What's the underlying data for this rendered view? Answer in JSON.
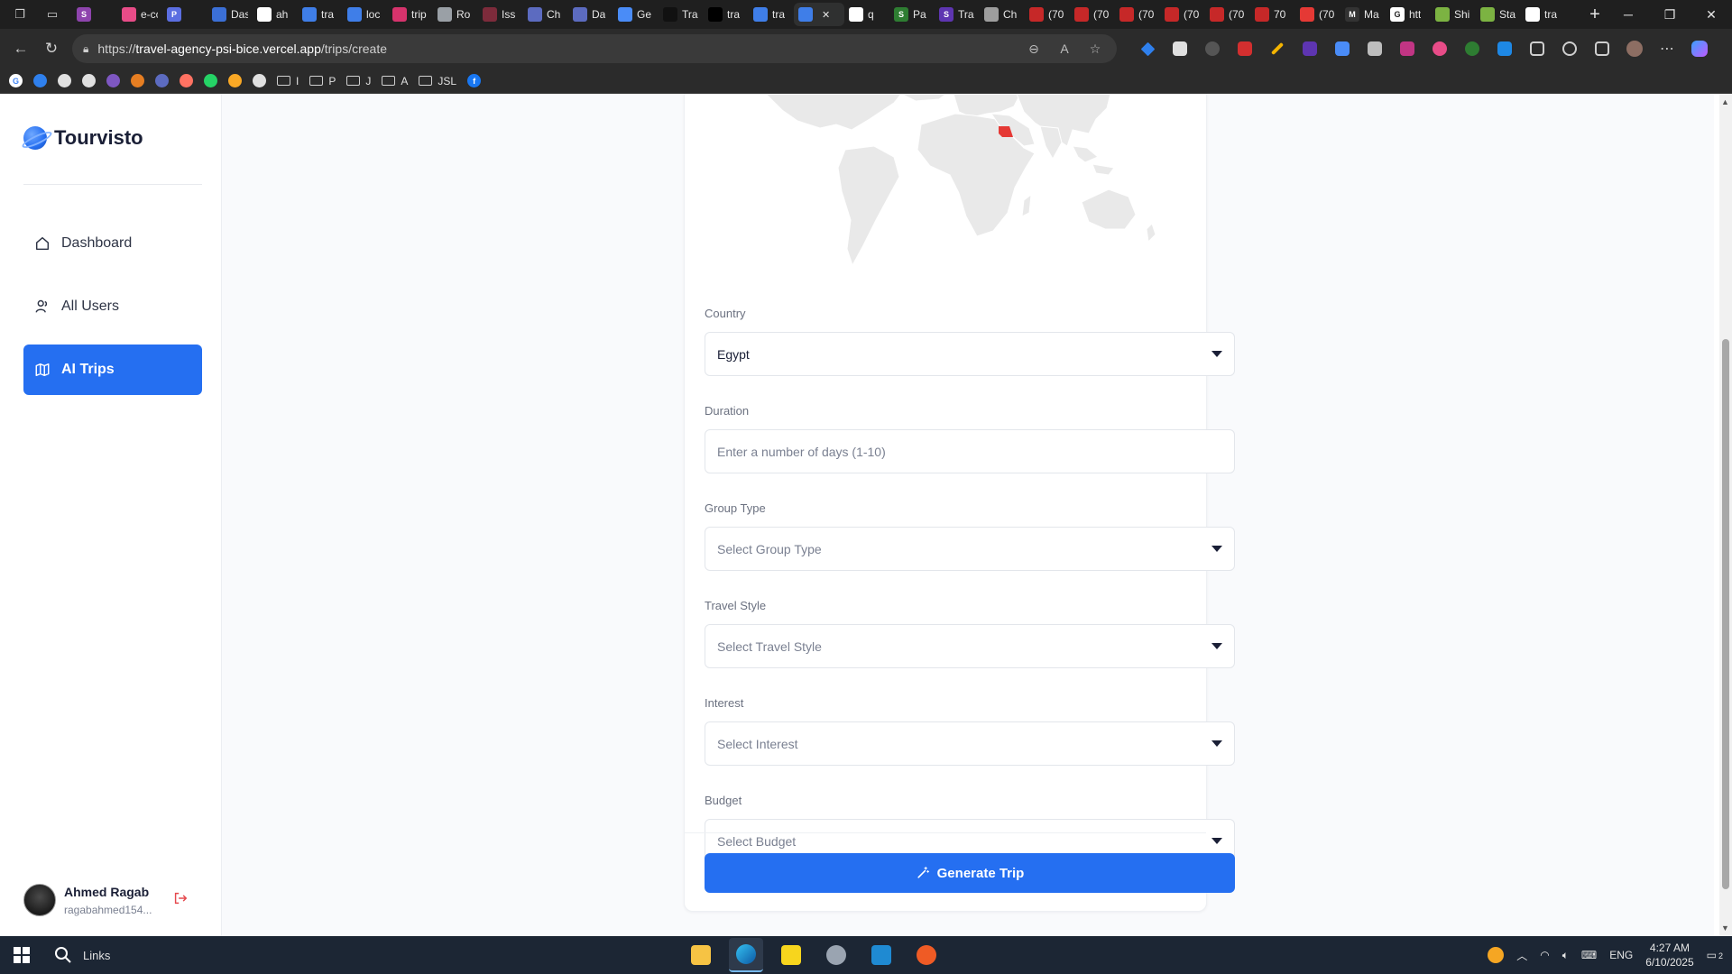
{
  "browser": {
    "tabs": [
      {
        "label": "",
        "color": "#8e44ad",
        "glyph": "S"
      },
      {
        "label": "e-cc",
        "color": "#e84c88",
        "glyph": ""
      },
      {
        "label": "",
        "color": "#5b6ee1",
        "glyph": "P"
      },
      {
        "label": "Das",
        "color": "#3b6fd6",
        "glyph": ""
      },
      {
        "label": "ah",
        "color": "#ffffff",
        "glyph": ""
      },
      {
        "label": "tra",
        "color": "#3f7ee8",
        "glyph": ""
      },
      {
        "label": "loc",
        "color": "#3f7ee8",
        "glyph": ""
      },
      {
        "label": "trip",
        "color": "#d6336c",
        "glyph": ""
      },
      {
        "label": "Ro",
        "color": "#9aa0a6",
        "glyph": ""
      },
      {
        "label": "Iss",
        "color": "#7d2b3b",
        "glyph": ""
      },
      {
        "label": "Ch",
        "color": "#5c6bc0",
        "glyph": ""
      },
      {
        "label": "Da",
        "color": "#5c6bc0",
        "glyph": ""
      },
      {
        "label": "Ge",
        "color": "#4a8cf7",
        "glyph": ""
      },
      {
        "label": "Tra",
        "color": "#111111",
        "glyph": ""
      },
      {
        "label": "tra",
        "color": "#000000",
        "glyph": ""
      },
      {
        "label": "tra",
        "color": "#3f7ee8",
        "glyph": ""
      },
      {
        "label": "",
        "color": "#3f7ee8",
        "glyph": ""
      },
      {
        "label": "q",
        "color": "#ffffff",
        "glyph": ""
      },
      {
        "label": "Pa",
        "color": "#2e7d32",
        "glyph": "S"
      },
      {
        "label": "Tra",
        "color": "#5e35b1",
        "glyph": "S"
      },
      {
        "label": "Ch",
        "color": "#9e9e9e",
        "glyph": ""
      },
      {
        "label": "(70",
        "color": "#c62828",
        "glyph": ""
      },
      {
        "label": "(70",
        "color": "#c62828",
        "glyph": ""
      },
      {
        "label": "(70",
        "color": "#c62828",
        "glyph": ""
      },
      {
        "label": "(70",
        "color": "#c62828",
        "glyph": ""
      },
      {
        "label": "(70",
        "color": "#c62828",
        "glyph": ""
      },
      {
        "label": "70",
        "color": "#c62828",
        "glyph": ""
      },
      {
        "label": "(70",
        "color": "#e53935",
        "glyph": ""
      },
      {
        "label": "Ma",
        "color": "#333333",
        "glyph": "M"
      },
      {
        "label": "htt",
        "color": "#ffffff",
        "glyph": "G"
      },
      {
        "label": "Shi",
        "color": "#7cb342",
        "glyph": ""
      },
      {
        "label": "Sta",
        "color": "#7cb342",
        "glyph": ""
      },
      {
        "label": "tra",
        "color": "#ffffff",
        "glyph": ""
      }
    ],
    "url_prefix": "https://",
    "url_host": "travel-agency-psi-bice.vercel.app",
    "url_path": "/trips/create",
    "bookmarks": [
      "I",
      "P",
      "J",
      "A",
      "JSL"
    ]
  },
  "app": {
    "brand": "Tourvisto",
    "nav": [
      {
        "label": "Dashboard",
        "icon": "home-icon"
      },
      {
        "label": "All Users",
        "icon": "users-icon"
      },
      {
        "label": "AI Trips",
        "icon": "map-icon",
        "active": true
      }
    ],
    "user": {
      "name": "Ahmed Ragab",
      "email": "ragabahmed154..."
    },
    "accent": "#256ff1",
    "highlight_color": "#e53935"
  },
  "form": {
    "country": {
      "label": "Country",
      "value": "Egypt"
    },
    "duration": {
      "label": "Duration",
      "placeholder": "Enter a number of days (1-10)"
    },
    "group_type": {
      "label": "Group Type",
      "placeholder": "Select Group Type"
    },
    "travel_style": {
      "label": "Travel Style",
      "placeholder": "Select Travel Style"
    },
    "interest": {
      "label": "Interest",
      "placeholder": "Select Interest"
    },
    "budget": {
      "label": "Budget",
      "placeholder": "Select Budget"
    },
    "submit": "Generate Trip"
  },
  "taskbar": {
    "search_label": "Links",
    "language": "ENG",
    "time": "4:27 AM",
    "date": "6/10/2025",
    "notifications": "2"
  }
}
